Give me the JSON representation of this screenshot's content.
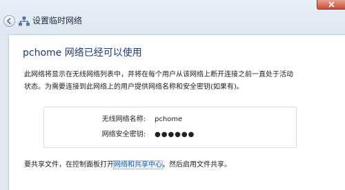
{
  "window": {
    "title": "设置临时网络"
  },
  "icons": {
    "back": "back-arrow-icon",
    "network": "network-icon",
    "close": "close-icon"
  },
  "main": {
    "heading": "pchome 网络已经可以使用",
    "description_line1": "此网络将显示在无线网络列表中，并将在每个用户从该网络上断开连接之前一直处于活动",
    "description_line2": "状态。为需要连接到此网络上的用户提供网络名称和安全密钥(如果有)。",
    "network_name_label": "无线网络名称:",
    "network_name_value": "pchome",
    "security_key_label": "网络安全密钥:",
    "security_key_value": "●●●●●●",
    "footer_prefix": "要共享文件，在控制面板打开",
    "footer_link": "网络和共享中心",
    "footer_suffix": "，然后启用文件共享。"
  },
  "colors": {
    "heading": "#1d3a78",
    "link": "#1a5fb4",
    "close_button": "#c74d38"
  }
}
